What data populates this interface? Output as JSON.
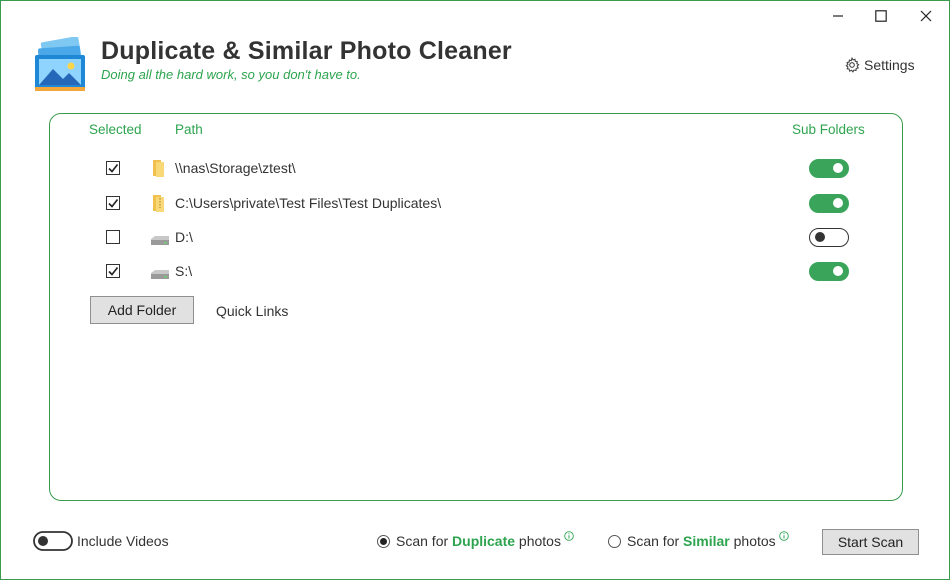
{
  "window": {
    "minimize_icon": "minimize-icon",
    "maximize_icon": "maximize-icon",
    "close_icon": "close-icon"
  },
  "header": {
    "title": "Duplicate & Similar Photo Cleaner",
    "tagline": "Doing all the hard work, so you don't have to.",
    "settings_label": "Settings",
    "settings_icon": "gear-icon"
  },
  "table": {
    "columns": {
      "selected": "Selected",
      "path": "Path",
      "sub_folders": "Sub Folders"
    },
    "rows": [
      {
        "selected": true,
        "icon": "folder-icon",
        "path": "\\\\nas\\Storage\\ztest\\",
        "sub_folders": true
      },
      {
        "selected": true,
        "icon": "folder-zip-icon",
        "path": "C:\\Users\\private\\Test Files\\Test Duplicates\\",
        "sub_folders": true
      },
      {
        "selected": false,
        "icon": "drive-icon",
        "path": "D:\\",
        "sub_folders": false
      },
      {
        "selected": true,
        "icon": "drive-icon",
        "path": "S:\\",
        "sub_folders": true
      }
    ],
    "add_folder_label": "Add Folder",
    "quick_links_label": "Quick Links"
  },
  "footer": {
    "include_videos_label": "Include Videos",
    "include_videos": false,
    "scan_duplicate": {
      "prefix": "Scan for ",
      "emph": "Duplicate",
      "suffix": " photos",
      "selected": true
    },
    "scan_similar": {
      "prefix": "Scan for ",
      "emph": "Similar",
      "suffix": " photos",
      "selected": false
    },
    "start_scan_label": "Start Scan"
  },
  "colors": {
    "accent": "#2ea44f",
    "border": "#3a9b4f",
    "toggle_on": "#3aa55a"
  }
}
